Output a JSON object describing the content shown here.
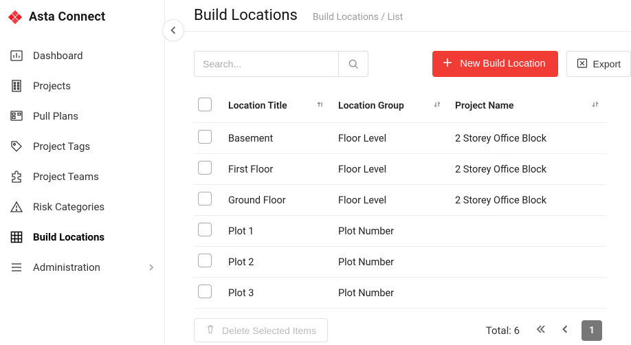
{
  "brand": "Asta Connect",
  "sidebar": {
    "items": [
      {
        "label": "Dashboard"
      },
      {
        "label": "Projects"
      },
      {
        "label": "Pull Plans"
      },
      {
        "label": "Project Tags"
      },
      {
        "label": "Project Teams"
      },
      {
        "label": "Risk Categories"
      },
      {
        "label": "Build Locations"
      },
      {
        "label": "Administration"
      }
    ]
  },
  "header": {
    "title": "Build Locations",
    "breadcrumb": "Build Locations / List"
  },
  "toolbar": {
    "search_placeholder": "Search...",
    "new_label": "New Build Location",
    "export_label": "Export"
  },
  "table": {
    "headers": {
      "title": "Location Title",
      "group": "Location Group",
      "project": "Project Name"
    },
    "rows": [
      {
        "title": "Basement",
        "group": "Floor Level",
        "project": "2 Storey Office Block"
      },
      {
        "title": "First Floor",
        "group": "Floor Level",
        "project": "2 Storey Office Block"
      },
      {
        "title": "Ground Floor",
        "group": "Floor Level",
        "project": "2 Storey Office Block"
      },
      {
        "title": "Plot 1",
        "group": "Plot Number",
        "project": ""
      },
      {
        "title": "Plot 2",
        "group": "Plot Number",
        "project": ""
      },
      {
        "title": "Plot 3",
        "group": "Plot Number",
        "project": ""
      }
    ]
  },
  "footer": {
    "delete_label": "Delete Selected Items",
    "total_label": "Total: 6",
    "current_page": "1"
  }
}
